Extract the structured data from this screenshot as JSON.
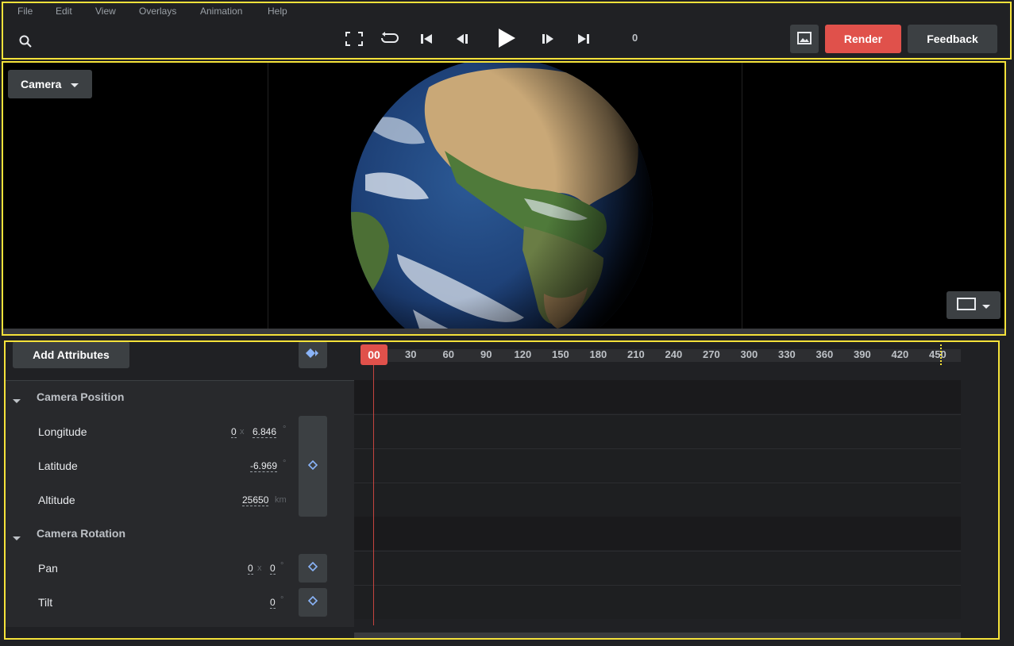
{
  "menu": [
    "File",
    "Edit",
    "View",
    "Overlays",
    "Animation",
    "Help"
  ],
  "toolbar": {
    "frame_counter": "0",
    "render_label": "Render",
    "feedback_label": "Feedback",
    "colors": {
      "render": "#e0514b",
      "feedback": "#3c4043"
    }
  },
  "viewport": {
    "camera_dropdown_label": "Camera"
  },
  "panel": {
    "add_attributes_label": "Add Attributes",
    "timeline": {
      "current_frame_label": "00",
      "ticks": [
        "30",
        "60",
        "90",
        "120",
        "150",
        "180",
        "210",
        "240",
        "270",
        "300",
        "330",
        "360",
        "390",
        "420",
        "450"
      ]
    },
    "groups": [
      {
        "title": "Camera Position"
      },
      {
        "title": "Camera Rotation"
      }
    ],
    "attributes": {
      "longitude": {
        "label": "Longitude",
        "mult": "0",
        "x": "x",
        "value": "6.846",
        "unit": "°"
      },
      "latitude": {
        "label": "Latitude",
        "value": "-6.969",
        "unit": "°"
      },
      "altitude": {
        "label": "Altitude",
        "value": "25650",
        "unit": "km"
      },
      "pan": {
        "label": "Pan",
        "mult": "0",
        "x": "x",
        "value": "0",
        "unit": "°"
      },
      "tilt": {
        "label": "Tilt",
        "value": "0",
        "unit": "°"
      }
    }
  }
}
